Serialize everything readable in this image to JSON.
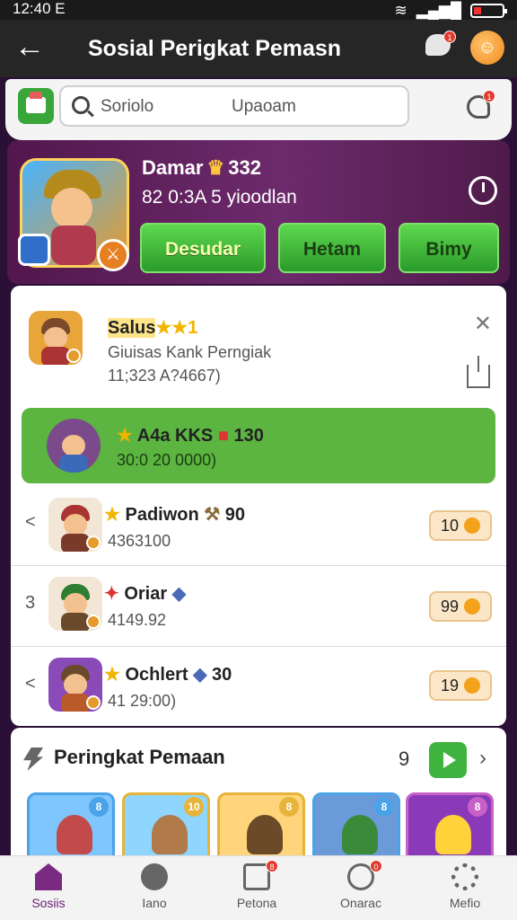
{
  "status_bar": {
    "time": "12:40 E",
    "wifi_icon": "wifi-icon",
    "signal_icon": "signal-icon",
    "battery_icon": "battery-icon"
  },
  "header": {
    "title": "Sosial Perigkat Pemasn",
    "back_icon": "arrow-left-icon",
    "chat_badge": "1",
    "avatar_icon": "emoji-avatar-icon"
  },
  "search": {
    "placeholder_left": "Soriolo",
    "placeholder_right": "Upaoam",
    "notif_badge": "1"
  },
  "profile": {
    "name": "Damar",
    "level": "332",
    "subtitle": "82 0:3A 5 yioodlan",
    "actions": [
      "Desudar",
      "Hetam",
      "Bimy"
    ]
  },
  "leaderboard": [
    {
      "rank": "",
      "name": "Salus",
      "stars": "★★1",
      "subtitle": "Giuisas Kank Perngiak",
      "meta": "11;323 A?4667)",
      "highlight": false
    },
    {
      "rank": "",
      "name": "A4a KKS",
      "level": "130",
      "subtitle": "30:0 20 0000)",
      "highlight": true
    },
    {
      "rank": "<",
      "name": "Padiwon",
      "level": "90",
      "subtitle": "4363100",
      "points": "10",
      "highlight": false
    },
    {
      "rank": "3",
      "name": "Oriar",
      "level": "",
      "subtitle": "4149.92",
      "points": "99",
      "highlight": false
    },
    {
      "rank": "<",
      "name": "Ochlert",
      "level": "30",
      "subtitle": "41 29:00)",
      "points": "19",
      "highlight": false
    }
  ],
  "section": {
    "title": "Peringkat Pemaan",
    "count": "9",
    "cards": [
      {
        "badge": "8",
        "border": "#4aa3e6",
        "bg": "#7fc6ff",
        "hero": "#c24a4a"
      },
      {
        "badge": "10",
        "border": "#e6b43a",
        "bg": "#8fd6ff",
        "hero": "#b07a4a"
      },
      {
        "badge": "8",
        "border": "#e6b43a",
        "bg": "#ffd47a",
        "hero": "#6b4a2a"
      },
      {
        "badge": "8",
        "border": "#4aa3e6",
        "bg": "#6a9bd8",
        "hero": "#3a8a3a"
      },
      {
        "badge": "8",
        "border": "#c860c8",
        "bg": "#8a3ab8",
        "hero": "#ffd23a"
      }
    ]
  },
  "bottom_nav": [
    {
      "label": "Sosiis",
      "icon": "home-icon",
      "active": true,
      "badge": ""
    },
    {
      "label": "Iano",
      "icon": "chat-icon",
      "active": false,
      "badge": ""
    },
    {
      "label": "Petona",
      "icon": "document-icon",
      "active": false,
      "badge": "8"
    },
    {
      "label": "Onarac",
      "icon": "message-icon",
      "active": false,
      "badge": "0"
    },
    {
      "label": "Mefio",
      "icon": "settings-icon",
      "active": false,
      "badge": ""
    }
  ]
}
